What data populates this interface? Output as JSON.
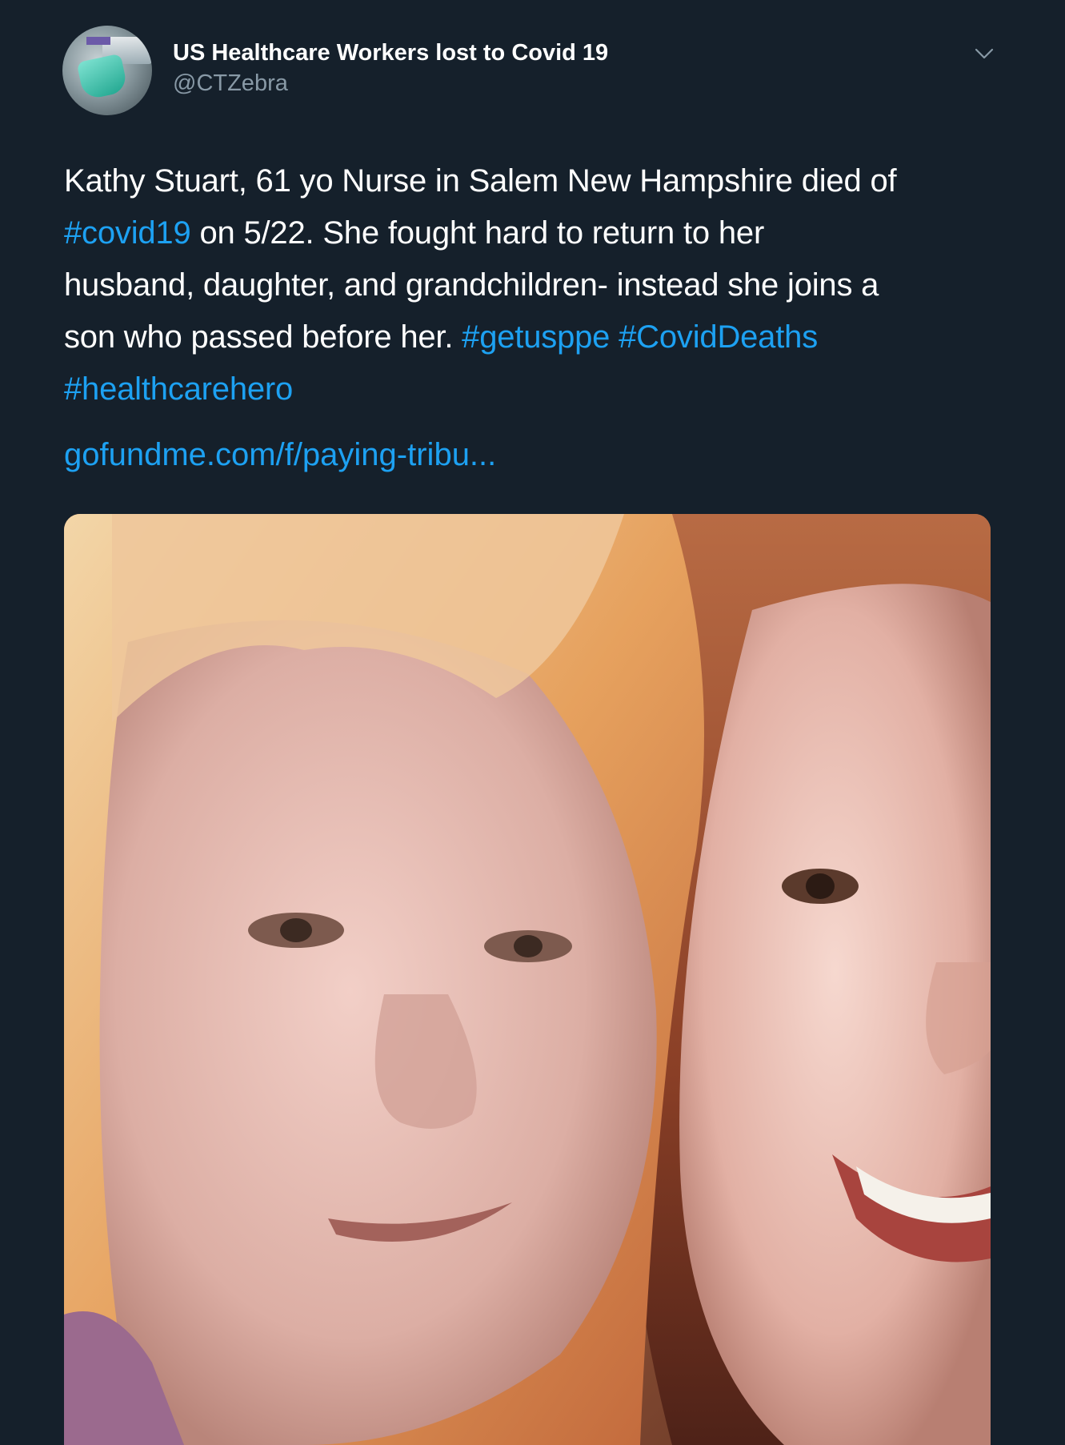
{
  "tweet": {
    "author": {
      "display_name": "US Healthcare Workers lost to Covid 19",
      "handle": "@CTZebra",
      "avatar_icon": "avatar-image"
    },
    "menu_icon": "chevron-down-icon",
    "text": {
      "line1": "Kathy Stuart, 61 yo Nurse in Salem New Hampshire died of",
      "line2_hashtag": "#covid19",
      "line2_rest": " on 5/22. She fought hard to return to her",
      "line3": "husband, daughter, and grandchildren- instead she joins a",
      "line4_text": "son who passed before her. ",
      "line4_hashtag1": "#getusppe",
      "line4_space": " ",
      "line4_hashtag2": "#CovidDeaths",
      "line5_hashtag": "#healthcarehero"
    },
    "link_text": "gofundme.com/f/paying-tribu...",
    "media": {
      "type": "photo"
    }
  },
  "colors": {
    "background": "#15202b",
    "link": "#1da1f2",
    "secondary_text": "#8899a6",
    "primary_text": "#ffffff"
  }
}
